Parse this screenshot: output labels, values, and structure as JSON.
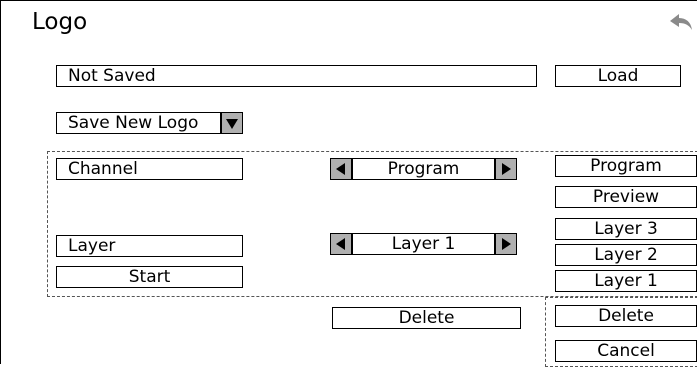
{
  "header": {
    "title": "Logo"
  },
  "status": {
    "text": "Not Saved"
  },
  "buttons": {
    "load": "Load",
    "save_new_logo": "Save New Logo",
    "start": "Start",
    "delete_center": "Delete",
    "delete_right": "Delete",
    "cancel": "Cancel"
  },
  "channel": {
    "label": "Channel",
    "value": "Program"
  },
  "layer": {
    "label": "Layer",
    "value": "Layer 1"
  },
  "channel_list": [
    "Program",
    "Preview"
  ],
  "layer_list": [
    "Layer 3",
    "Layer 2",
    "Layer 1"
  ]
}
